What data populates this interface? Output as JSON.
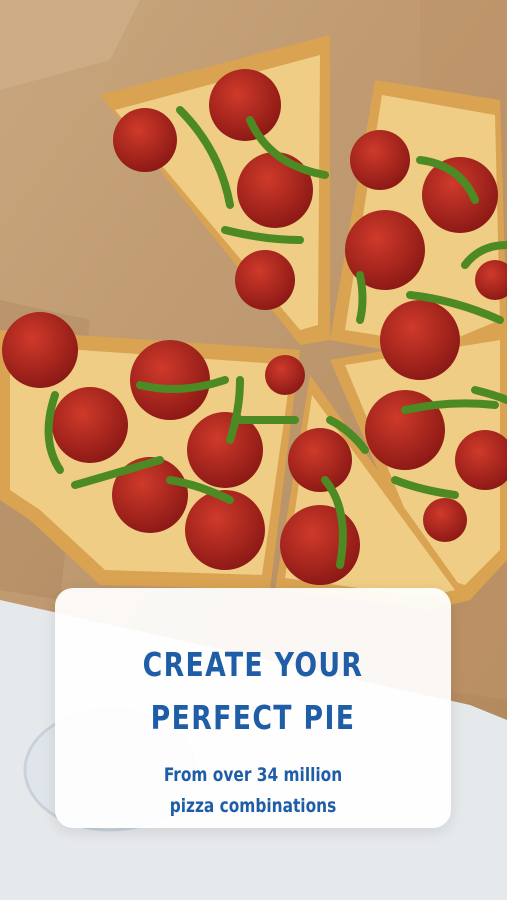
{
  "promo": {
    "image_alt": "pepperoni and green pepper pizza in a box",
    "headline_line1": "CREATE YOUR",
    "headline_line2": "PERFECT PIE",
    "subtext_line1": "From over 34 million",
    "subtext_line2": "pizza combinations"
  },
  "colors": {
    "accent": "#1f5ea7",
    "card_bg": "#ffffff",
    "box": "#c59f74",
    "crust": "#d9a352",
    "cheese": "#f0cf86",
    "pepperoni": "#b2231d",
    "pepper": "#4d8a24"
  }
}
